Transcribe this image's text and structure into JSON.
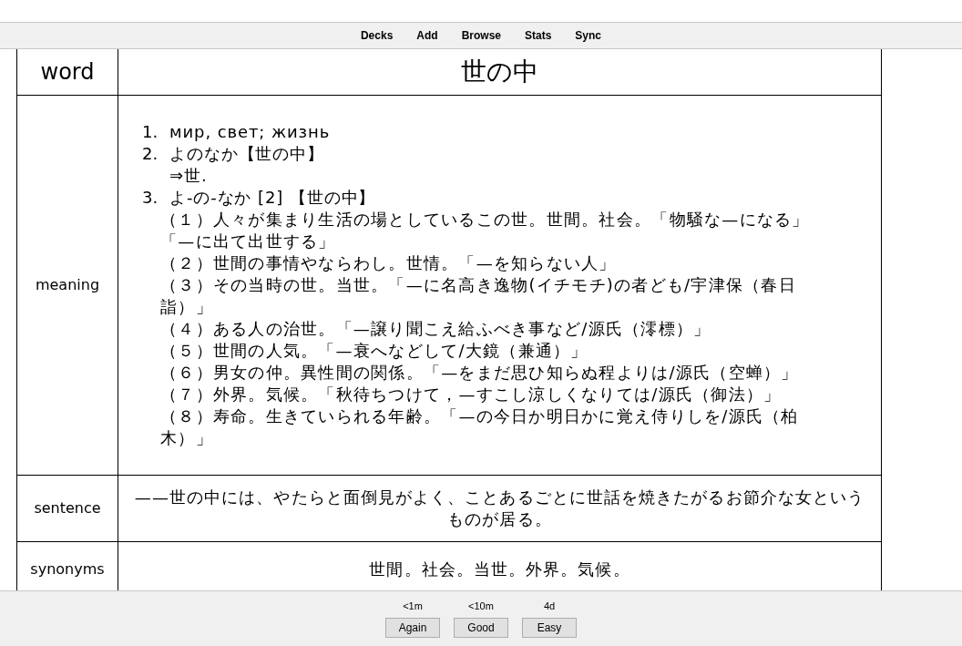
{
  "menu": [
    "Decks",
    "Add",
    "Browse",
    "Stats",
    "Sync"
  ],
  "fields": [
    {
      "kind": "word",
      "label": "word",
      "value": "世の中"
    },
    {
      "kind": "meaning",
      "label": "meaning",
      "items": [
        {
          "number": "1.",
          "lines": [
            "мир, свет; жизнь"
          ]
        },
        {
          "number": "2.",
          "lines": [
            "よのなか【世の中】",
            "⇒世."
          ]
        },
        {
          "number": "3.",
          "lines": [
            "よ-の-なか [2] 【世の中】"
          ],
          "senses": [
            "（１）人々が集まり生活の場としているこの世。世間。社会。「物騒な—になる」「—に出て出世する」",
            "（２）世間の事情やならわし。世情。「—を知らない人」",
            "（３）その当時の世。当世。「—に名高き逸物(イチモチ)の者ども/宇津保（春日詣）」",
            "（４）ある人の治世。「—譲り聞こえ給ふべき事など/源氏（澪標）」",
            "（５）世間の人気。「—衰へなどして/大鏡（兼通）」",
            "（６）男女の仲。異性間の関係。「—をまだ思ひ知らぬ程よりは/源氏（空蝉）」",
            "（７）外界。気候。「秋待ちつけて，—すこし涼しくなりては/源氏（御法）」",
            "（８）寿命。生きていられる年齢。「—の今日か明日かに覚え侍りしを/源氏（柏木）」"
          ]
        }
      ]
    },
    {
      "kind": "text",
      "label": "sentence",
      "value": "——世の中には、やたらと面倒見がよく、ことあるごとに世話を焼きたがるお節介な女というものが居る。"
    },
    {
      "kind": "text",
      "label": "synonyms",
      "value": "世間。社会。当世。外界。気候。"
    }
  ],
  "answers": [
    {
      "time": "<1m",
      "label": "Again"
    },
    {
      "time": "<10m",
      "label": "Good"
    },
    {
      "time": "4d",
      "label": "Easy"
    }
  ]
}
